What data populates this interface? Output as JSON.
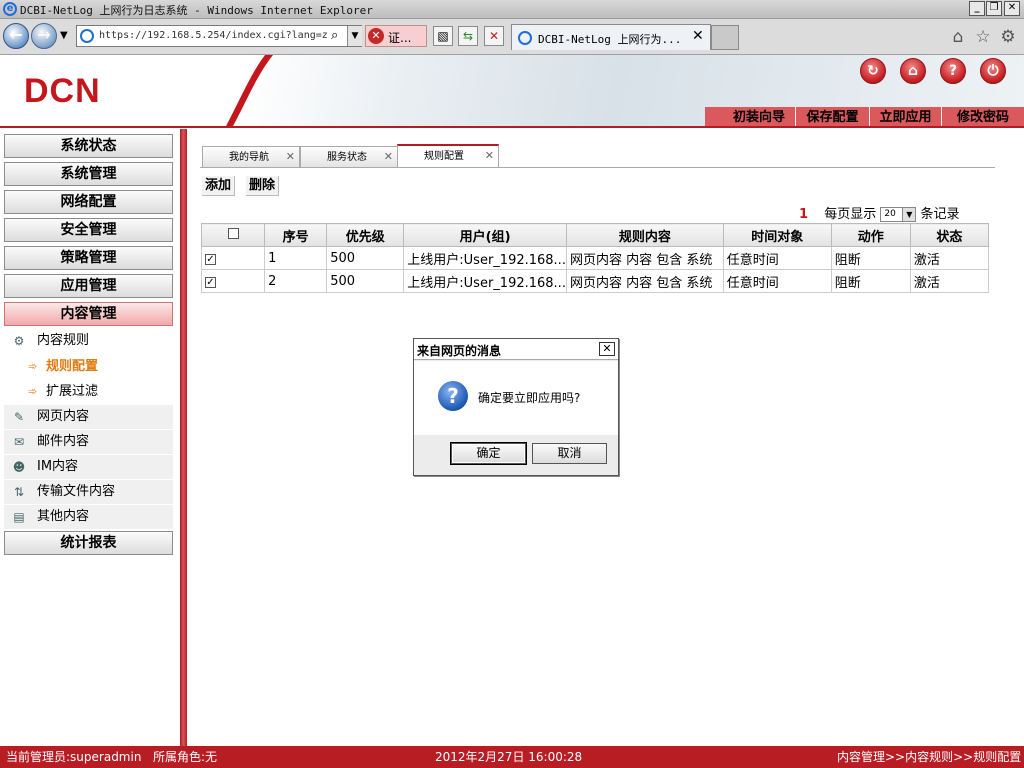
{
  "window": {
    "title": "DCBI-NetLog 上网行为日志系统 - Windows Internet Explorer",
    "controls": [
      "_",
      "❐",
      "✕"
    ]
  },
  "browser": {
    "url": "https://192.168.5.254/index.cgi?lang=z",
    "cert_label": "证...",
    "tab_title": "DCBI-NetLog 上网行为...",
    "tab_close": "✕"
  },
  "app": {
    "logo": "DCN",
    "brand_color": "#c4161c",
    "top_menu": [
      "初装向导",
      "保存配置",
      "立即应用",
      "修改密码"
    ]
  },
  "sidebar": {
    "menu_top": [
      "系统状态",
      "系统管理",
      "网络配置",
      "安全管理",
      "策略管理",
      "应用管理",
      "内容管理"
    ],
    "active": "内容管理",
    "submenu": [
      {
        "label": "内容规则",
        "icon": "gear-icon",
        "children": [
          {
            "label": "规则配置",
            "active": true
          },
          {
            "label": "扩展过滤",
            "active": false
          }
        ]
      },
      {
        "label": "网页内容",
        "icon": "web-icon"
      },
      {
        "label": "邮件内容",
        "icon": "mail-icon"
      },
      {
        "label": "IM内容",
        "icon": "im-icon"
      },
      {
        "label": "传输文件内容",
        "icon": "file-transfer-icon"
      },
      {
        "label": "其他内容",
        "icon": "other-icon"
      }
    ],
    "menu_bottom": [
      "统计报表"
    ]
  },
  "content": {
    "tabs": [
      {
        "label": "我的导航",
        "active": false
      },
      {
        "label": "服务状态",
        "active": false
      },
      {
        "label": "规则配置",
        "active": true
      }
    ],
    "actions": {
      "add": "添加",
      "delete": "删除"
    },
    "pager": {
      "page": "1",
      "per_page_label": "每页显示",
      "per_page_value": "20",
      "records_label": "条记录"
    },
    "table": {
      "headers": [
        "",
        "序号",
        "优先级",
        "用户(组)",
        "规则内容",
        "时间对象",
        "动作",
        "状态"
      ],
      "rows": [
        {
          "checked": true,
          "no": "1",
          "priority": "500",
          "user": "上线用户:User_192.168...",
          "rule": "网页内容 内容 包含 系统",
          "time": "任意时间",
          "action": "阻断",
          "status": "激活"
        },
        {
          "checked": true,
          "no": "2",
          "priority": "500",
          "user": "上线用户:User_192.168...",
          "rule": "网页内容 内容 包含 系统",
          "time": "任意时间",
          "action": "阻断",
          "status": "激活"
        }
      ]
    }
  },
  "dialog": {
    "title": "来自网页的消息",
    "message": "确定要立即应用吗?",
    "ok": "确定",
    "cancel": "取消"
  },
  "status_bar": {
    "admin": "当前管理员:superadmin",
    "role": "所属角色:无",
    "datetime": "2012年2月27日 16:00:28",
    "breadcrumb": "内容管理>>内容规则>>规则配置"
  }
}
